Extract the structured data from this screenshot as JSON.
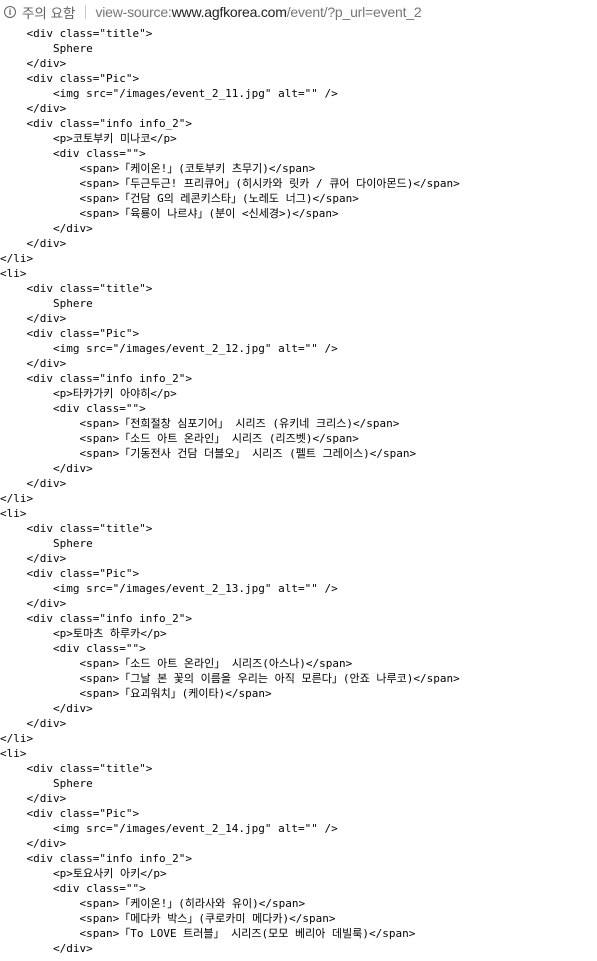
{
  "addressbar": {
    "info_icon": "info-icon",
    "security_label": "주의 요함",
    "url_prefix": "view-source:",
    "url_host": "www.agfkorea.com",
    "url_path": "/event/?p_url=event_2"
  },
  "source_lines": [
    "    <div class=\"title\">",
    "        Sphere",
    "    </div>",
    "    <div class=\"Pic\">",
    "        <img src=\"/images/event_2_11.jpg\" alt=\"\" />",
    "    </div>",
    "    <div class=\"info info_2\">",
    "        <p>코토부키 미나코</p>",
    "        <div class=\"\">",
    "            <span>「케이온!」(코토부키 츠무기)</span>",
    "            <span>「두근두근! 프리큐어」(히시카와 릿카 / 큐어 다이아몬드)</span>",
    "            <span>「건담 G의 레콘키스타」(노레도 너그)</span>",
    "            <span>「육룡이 나르샤」(분이 <신세경>)</span>",
    "        </div>",
    "    </div>",
    "</li>",
    "<li>",
    "    <div class=\"title\">",
    "        Sphere",
    "    </div>",
    "    <div class=\"Pic\">",
    "        <img src=\"/images/event_2_12.jpg\" alt=\"\" />",
    "    </div>",
    "    <div class=\"info info_2\">",
    "        <p>타카가키 아야히</p>",
    "        <div class=\"\">",
    "            <span>「전희절창 심포기어」 시리즈 (유키네 크리스)</span>",
    "            <span>「소드 아트 온라인」 시리즈 (리즈벳)</span>",
    "            <span>「기동전사 건담 더블오」 시리즈 (펠트 그레이스)</span>",
    "        </div>",
    "    </div>",
    "</li>",
    "<li>",
    "    <div class=\"title\">",
    "        Sphere",
    "    </div>",
    "    <div class=\"Pic\">",
    "        <img src=\"/images/event_2_13.jpg\" alt=\"\" />",
    "    </div>",
    "    <div class=\"info info_2\">",
    "        <p>토마츠 하루카</p>",
    "        <div class=\"\">",
    "            <span>「소드 아트 온라인」 시리즈(아스나)</span>",
    "            <span>「그날 본 꽃의 이름을 우리는 아직 모른다」(안죠 나루코)</span>",
    "            <span>「요괴워치」(케이타)</span>",
    "        </div>",
    "    </div>",
    "</li>",
    "<li>",
    "    <div class=\"title\">",
    "        Sphere",
    "    </div>",
    "    <div class=\"Pic\">",
    "        <img src=\"/images/event_2_14.jpg\" alt=\"\" />",
    "    </div>",
    "    <div class=\"info info_2\">",
    "        <p>토요사키 아키</p>",
    "        <div class=\"\">",
    "            <span>「케이온!」(히라사와 유이)</span>",
    "            <span>「메다카 박스」(쿠로카미 메다카)</span>",
    "            <span>「To LOVE 트러블」 시리즈(모모 베리아 데빌룩)</span>",
    "        </div>"
  ]
}
